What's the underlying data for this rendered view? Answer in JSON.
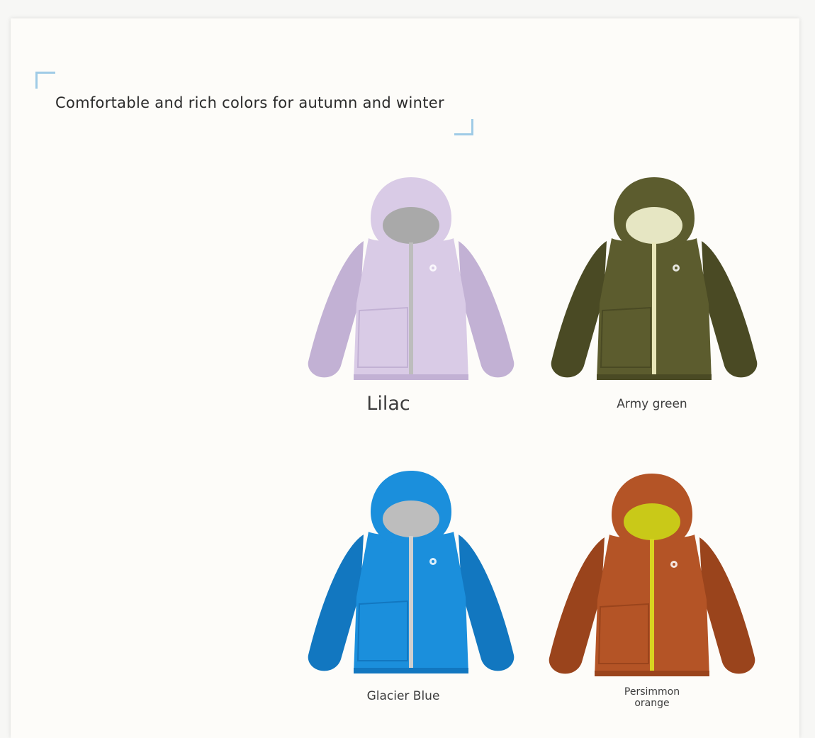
{
  "headline": "Comfortable and rich colors for autumn and winter",
  "colors": [
    {
      "label": "Lilac",
      "body": "#d9cbe6",
      "shade": "#c2b1d4",
      "lining": "#a9a9a9",
      "zip": "#bdbdbd",
      "icon": "jacket-lilac-icon"
    },
    {
      "label": "Army green",
      "body": "#5c5c2e",
      "shade": "#4a4a24",
      "lining": "#e6e6c3",
      "zip": "#e8e6b8",
      "icon": "jacket-army-green-icon"
    },
    {
      "label": "Glacier Blue",
      "body": "#1b8fdc",
      "shade": "#1277c0",
      "lining": "#bdbdbd",
      "zip": "#cfcfcf",
      "icon": "jacket-glacier-blue-icon"
    },
    {
      "label": "Persimmon\norange",
      "body": "#b45426",
      "shade": "#9a441c",
      "lining": "#c9c918",
      "zip": "#d8d420",
      "icon": "jacket-persimmon-orange-icon"
    }
  ]
}
